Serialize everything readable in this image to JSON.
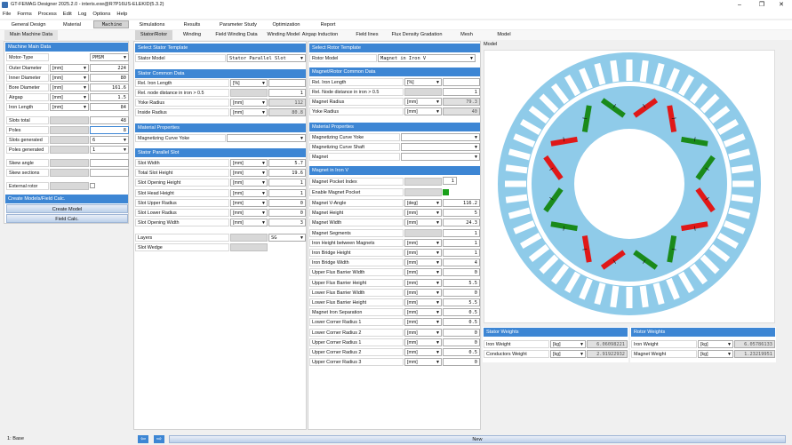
{
  "window": {
    "title": "GT-FEMAG Designer 2025.2.0 - interis.exe@R7P16US-ELEKID(5.3.2)"
  },
  "menu": [
    "File",
    "Forms",
    "Process",
    "Edit",
    "Log",
    "Options",
    "Help"
  ],
  "main_tabs": [
    "General Design",
    "Material",
    "Machine",
    "Simulations",
    "Results",
    "Parameter Study",
    "Optimization",
    "Report"
  ],
  "sub_tabs": [
    "Main Machine Data",
    "Stator/Rotor",
    "Winding",
    "Field Winding Data",
    "Winding Model",
    "Airgap Induction",
    "Field lines",
    "Flux Density Gradation",
    "Mesh",
    "Model"
  ],
  "machine_main": {
    "header": "Machine Main Data",
    "motor_type": {
      "label": "Motor-Type",
      "value": "PMSM"
    },
    "rows": [
      {
        "label": "Outer Diameter",
        "unit": "[mm]",
        "value": "224"
      },
      {
        "label": "Inner Diameter",
        "unit": "[mm]",
        "value": "80"
      },
      {
        "label": "Bore Diameter",
        "unit": "[mm]",
        "value": "161.6"
      },
      {
        "label": "Airgap",
        "unit": "[mm]",
        "value": "1.5"
      },
      {
        "label": "Iron Length",
        "unit": "[mm]",
        "value": "84"
      }
    ],
    "slots_total": {
      "label": "Slots total",
      "value": "48"
    },
    "poles": {
      "label": "Poles",
      "value": "8"
    },
    "slots_generated": {
      "label": "Slots generated",
      "value": "6"
    },
    "poles_generated": {
      "label": "Poles generated",
      "value": "1"
    },
    "skew_angle": {
      "label": "Skew angle"
    },
    "skew_sections": {
      "label": "Skew sections"
    },
    "external_rotor": {
      "label": "External rotor"
    }
  },
  "create": {
    "header": "Create Models/Field Calc.",
    "create_model": "Create Model",
    "field_calc": "Field Calc."
  },
  "stator_template": {
    "header": "Select Stator Template",
    "label": "Stator Model",
    "value": "Stator Parallel Slot"
  },
  "stator_common": {
    "header": "Stator Common Data",
    "rows": [
      {
        "label": "Rel. Iron Length",
        "unit": "[%]",
        "value": ""
      },
      {
        "label": "Rel. node distance in iron > 0.5",
        "unit": "",
        "value": "1"
      },
      {
        "label": "Yoke Radius",
        "unit": "[mm]",
        "value": "112"
      },
      {
        "label": "Inside Radius",
        "unit": "[mm]",
        "value": "80.8"
      }
    ]
  },
  "stator_material": {
    "header": "Material Properties",
    "label": "Magnetizing Curve Yoke",
    "value": ""
  },
  "stator_slot": {
    "header": "Stator Parallel Slot",
    "rows": [
      {
        "label": "Slot Width",
        "unit": "[mm]",
        "value": "5.7"
      },
      {
        "label": "Total Slot Height",
        "unit": "[mm]",
        "value": "19.6"
      },
      {
        "label": "Slot Opening Height",
        "unit": "[mm]",
        "value": "1"
      },
      {
        "label": "Slot Head Height",
        "unit": "[mm]",
        "value": "1"
      },
      {
        "label": "Slot Upper Radius",
        "unit": "[mm]",
        "value": "0"
      },
      {
        "label": "Slot Lower Radius",
        "unit": "[mm]",
        "value": "0"
      },
      {
        "label": "Slot Opening Width",
        "unit": "[mm]",
        "value": "3"
      }
    ],
    "layers": {
      "label": "Layers",
      "value": "SG"
    },
    "slot_wedge": {
      "label": "Slot Wedge"
    }
  },
  "rotor_template": {
    "header": "Select Rotor Template",
    "label": "Rotor Model",
    "value": "Magnet in Iron V"
  },
  "rotor_common": {
    "header": "Magnet/Rotor Common Data",
    "rows": [
      {
        "label": "Rel. Iron Length",
        "unit": "[%]",
        "value": ""
      },
      {
        "label": "Rel. Node distance in iron > 0.5",
        "unit": "",
        "value": "1"
      },
      {
        "label": "Magnet Radius",
        "unit": "[mm]",
        "value": "79.3"
      },
      {
        "label": "Yoke Radius",
        "unit": "[mm]",
        "value": "40"
      }
    ]
  },
  "rotor_material": {
    "header": "Material Properties",
    "rows": [
      {
        "label": "Magnetizing Curve Yoke",
        "value": ""
      },
      {
        "label": "Magnetizing Curve Shaft",
        "value": ""
      },
      {
        "label": "Magnet",
        "value": ""
      }
    ]
  },
  "magnet_v": {
    "header": "Magnet in Iron V",
    "pocket_index": {
      "label": "Magnet Pocket Index",
      "value": "1"
    },
    "enable_pocket": {
      "label": "Enable Magnet Pocket"
    },
    "rows": [
      {
        "label": "Magnet V-Angle",
        "unit": "[deg]",
        "value": "116.2"
      },
      {
        "label": "Magnet Height",
        "unit": "[mm]",
        "value": "5"
      },
      {
        "label": "Magnet Width",
        "unit": "[mm]",
        "value": "24.3"
      },
      {
        "label": "Magnet Segments",
        "unit": "",
        "value": "1"
      },
      {
        "label": "Iron Height between Magnets",
        "unit": "[mm]",
        "value": "1"
      },
      {
        "label": "Iron Bridge Height",
        "unit": "[mm]",
        "value": "1"
      },
      {
        "label": "Iron Bridge Width",
        "unit": "[mm]",
        "value": "4"
      },
      {
        "label": "Upper Flux Barrier Width",
        "unit": "[mm]",
        "value": "0"
      },
      {
        "label": "Upper Flux Barrier Height",
        "unit": "[mm]",
        "value": "5.5"
      },
      {
        "label": "Lower Flux Barrier Width",
        "unit": "[mm]",
        "value": "0"
      },
      {
        "label": "Lower Flux Barrier Height",
        "unit": "[mm]",
        "value": "5.5"
      },
      {
        "label": "Magnet Iron Separation",
        "unit": "[mm]",
        "value": "0.5"
      },
      {
        "label": "Lower Corner Radius 1",
        "unit": "[mm]",
        "value": "0.5"
      },
      {
        "label": "Lower Corner Radius 2",
        "unit": "[mm]",
        "value": "0"
      },
      {
        "label": "Upper Corner Radius 1",
        "unit": "[mm]",
        "value": "0"
      },
      {
        "label": "Upper Corner Radius 2",
        "unit": "[mm]",
        "value": "0.5"
      },
      {
        "label": "Upper Corner Radius 3",
        "unit": "[mm]",
        "value": "0"
      }
    ]
  },
  "model": {
    "header": "Model"
  },
  "stator_weights": {
    "header": "Stator Weights",
    "rows": [
      {
        "label": "Iron Weight",
        "unit": "[kg]",
        "value": "6.06098221"
      },
      {
        "label": "Conductors Weight",
        "unit": "[kg]",
        "value": "2.91922932"
      }
    ]
  },
  "rotor_weights": {
    "header": "Rotor Weights",
    "rows": [
      {
        "label": "Iron Weight",
        "unit": "[kg]",
        "value": "6.05786133"
      },
      {
        "label": "Magnet Weight",
        "unit": "[kg]",
        "value": "1.23219951"
      }
    ]
  },
  "status": {
    "left": "1: Base",
    "new_label": "New"
  },
  "colors": {
    "accent": "#3d86d4",
    "stator": "#8fcbe9",
    "magnet_red": "#e01818",
    "magnet_green": "#1a8a1a"
  }
}
